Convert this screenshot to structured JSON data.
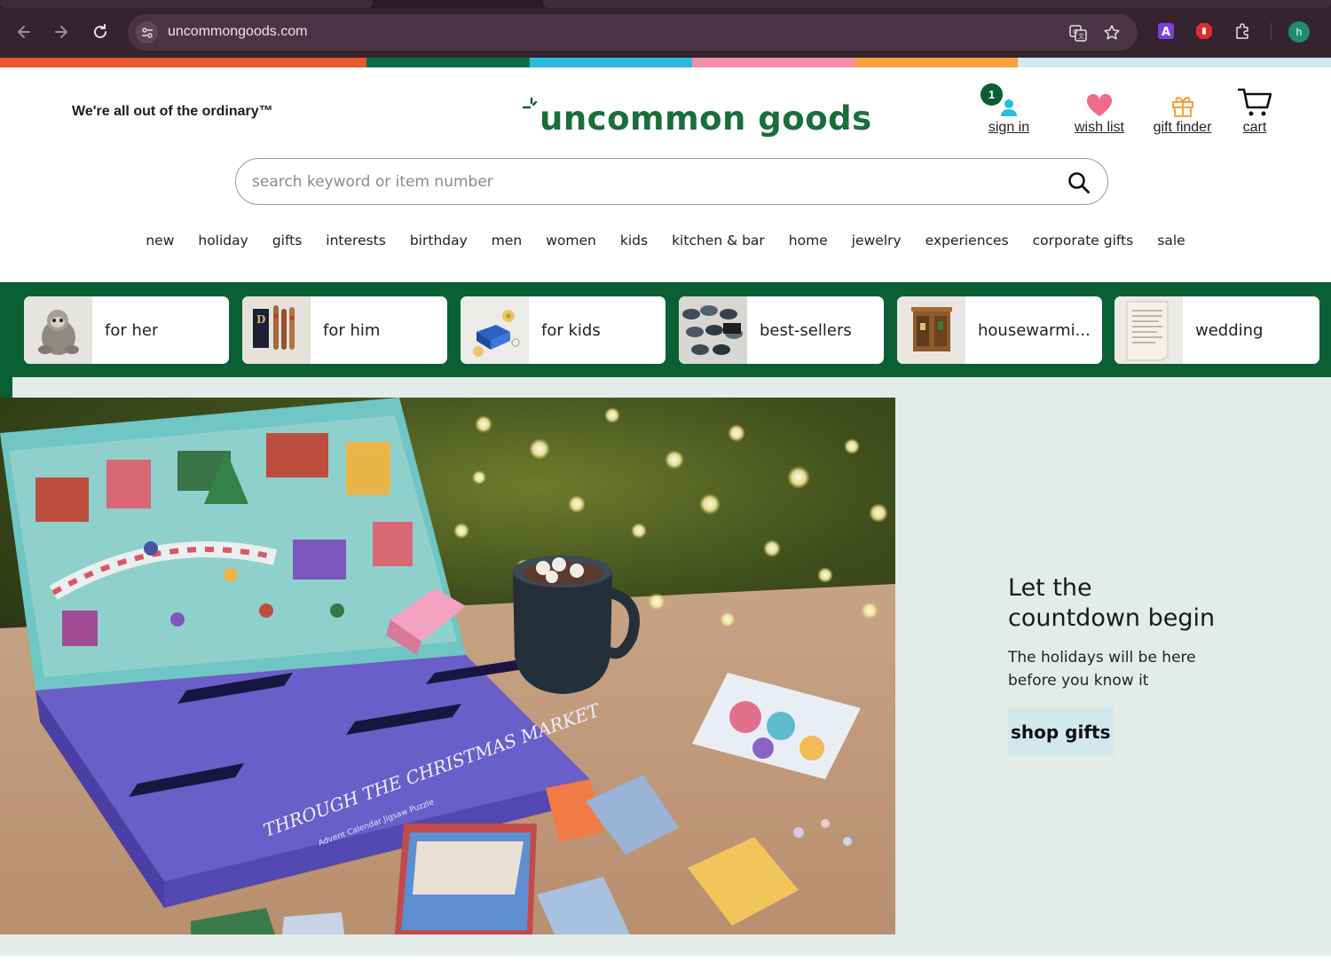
{
  "browser": {
    "url": "uncommongoods.com",
    "profile_initial": "h",
    "icons": [
      "back-icon",
      "forward-icon",
      "reload-icon",
      "site-info-icon",
      "translate-icon",
      "star-icon",
      "extension-a-icon",
      "extension-stop-icon",
      "extensions-puzzle-icon"
    ]
  },
  "color_strip": [
    "#e8582a",
    "#0d6b45",
    "#2bbbe0",
    "#f08fa6",
    "#f6a13c",
    "#cfe9ee"
  ],
  "header": {
    "tagline": "We're all out of the ordinary™",
    "logo_text": "uncommon goods",
    "sign_in_badge": "1",
    "sign_in": "sign in",
    "wish_list": "wish list",
    "gift_finder": "gift finder",
    "cart": "cart"
  },
  "search": {
    "placeholder": "search keyword or item number",
    "value": ""
  },
  "nav": {
    "items": [
      "new",
      "holiday",
      "gifts",
      "interests",
      "birthday",
      "men",
      "women",
      "kids",
      "kitchen & bar",
      "home",
      "jewelry",
      "experiences",
      "corporate gifts",
      "sale"
    ]
  },
  "categories": [
    {
      "label": "for her"
    },
    {
      "label": "for him"
    },
    {
      "label": "for kids"
    },
    {
      "label": "best-sellers"
    },
    {
      "label": "housewarmi..."
    },
    {
      "label": "wedding"
    }
  ],
  "hero": {
    "title_line1": "Let the",
    "title_line2": "countdown begin",
    "subtitle": "The holidays will be here before you know it",
    "cta": "shop gifts",
    "box_title": "THROUGH THE CHRISTMAS MARKET",
    "box_subtitle": "Advent Calendar Jigsaw Puzzle"
  },
  "colors": {
    "brand_green": "#0b5f35",
    "logo_green": "#1a6e3c",
    "hero_bg": "#e3ece8",
    "cta_bg": "#d3e8ea"
  }
}
